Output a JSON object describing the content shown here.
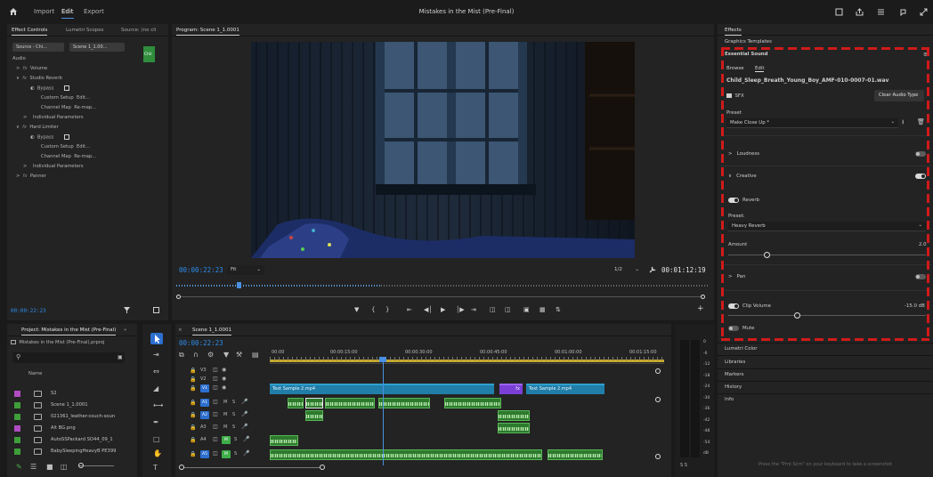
{
  "menu": {
    "import": "Import",
    "edit": "Edit",
    "export": "Export"
  },
  "window_title": "Mistakes in the Mist (Pre-Final)",
  "effect_controls": {
    "tabs": [
      "Effect Controls",
      "Lumetri Scopes",
      "Source: (no cli"
    ],
    "source_tab": "Source - Chi...",
    "sequence_tab": "Scene 1_1.00...",
    "audio_label": "Audio",
    "clip_chip": "Chil",
    "rows": {
      "volume": "Volume",
      "studio_reverb": "Studio Reverb",
      "bypass1": "Bypass",
      "custom_setup1": "Custom Setup",
      "edit1": "Edit...",
      "channel_map1": "Channel Map",
      "remap1": "Re-map...",
      "individual1": "Individual Parameters",
      "hard_limiter": "Hard Limiter",
      "bypass2": "Bypass",
      "custom_setup2": "Custom Setup",
      "edit2": "Edit...",
      "channel_map2": "Channel Map",
      "remap2": "Re-map...",
      "individual2": "Individual Parameters",
      "panner": "Panner"
    },
    "timecode": "00:00:22:23"
  },
  "program": {
    "title": "Program: Scene 1_1.0001",
    "timecode": "00:00:22:23",
    "fit": "Fit",
    "resolution": "1/2",
    "duration": "00:01:12:19"
  },
  "effects": {
    "title": "Effects",
    "graphics_templates": "Graphics Templates",
    "essential_sound": "Essential Sound",
    "browse": "Browse",
    "edit": "Edit",
    "clip_name": "Child_Sleep_Breath_Young_Boy_AMF-010-0007-01.wav",
    "sfx": "SFX",
    "clear_audio_type": "Clear Audio Type",
    "preset_label": "Preset",
    "preset_value": "Make Close Up *",
    "loudness": "Loudness",
    "creative": "Creative",
    "reverb": "Reverb",
    "reverb_preset_label": "Preset:",
    "reverb_preset_value": "Heavy Reverb",
    "amount_label": "Amount",
    "amount_value": "2.0",
    "pan": "Pan",
    "clip_volume": "Clip Volume",
    "clip_volume_value": "-15.0 dB",
    "mute": "Mute",
    "lumetri_color": "Lumetri Color",
    "libraries": "Libraries",
    "markers": "Markers",
    "history": "History",
    "info": "Info",
    "prtscn_hint": "Press the \"Prnt Scrn\" on your keyboard to take a screenshot"
  },
  "project": {
    "title": "Project: Mistakes in the Mist (Pre-Final)",
    "file": "Mistakes in the Mist (Pre-Final).prproj",
    "name_header": "Name",
    "items": [
      {
        "name": "S2",
        "color": "#b04cc1"
      },
      {
        "name": "Scene 1_1.0001",
        "color": "#3f9d3a"
      },
      {
        "name": "021361_leather-couch-soun",
        "color": "#3f9d3a"
      },
      {
        "name": "Alt BG.png",
        "color": "#b04cc1"
      },
      {
        "name": "AutoSSPackard SO44_09_1",
        "color": "#3f9d3a"
      },
      {
        "name": "BabySleepingHeavyB PE399",
        "color": "#3f9d3a"
      }
    ]
  },
  "timeline": {
    "tab": "Scene 1_1.0001",
    "timecode": "00:00:22:23",
    "ruler": [
      "00:00",
      "00:00:15:00",
      "00:00:30:00",
      "00:00:45:00",
      "00:01:00:00",
      "00:01:15:00"
    ],
    "tracks": {
      "v3": "V3",
      "v2": "V2",
      "v1": "V1",
      "a1": "A1",
      "a2": "A2",
      "a3": "A3",
      "a4": "A4",
      "a5": "A5",
      "m": "M",
      "s": "S"
    },
    "clips": {
      "text1": "Text Sample 2.mp4",
      "fx": "fx",
      "text2": "Text Sample 2.mp4"
    }
  },
  "meter": {
    "scale": [
      "0",
      "-6",
      "-12",
      "-18",
      "-24",
      "-30",
      "-36",
      "-42",
      "-48",
      "-54",
      "dB"
    ],
    "channels": "S S"
  },
  "colors": {
    "accent": "#2d8ceb",
    "highlight": "#d11a1a",
    "video_clip": "#217ea8",
    "audio_clip": "#2d7a2d",
    "fx_clip": "#7b3fd6"
  }
}
